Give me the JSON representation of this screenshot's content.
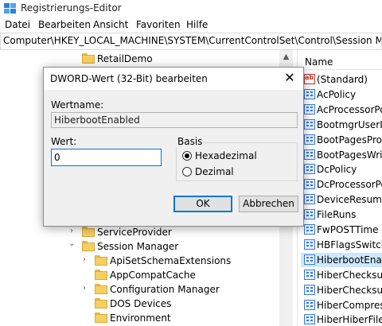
{
  "window": {
    "title": "Registrierungs-Editor",
    "menu": [
      "Datei",
      "Bearbeiten",
      "Ansicht",
      "Favoriten",
      "Hilfe"
    ],
    "address": "Computer\\HKEY_LOCAL_MACHINE\\SYSTEM\\CurrentControlSet\\Control\\Session Manager\\Power"
  },
  "tree": {
    "items": [
      {
        "label": "RetailDemo",
        "expander": ""
      },
      {
        "label": "ServiceProvider",
        "expander": "›"
      },
      {
        "label": "Session Manager",
        "expander": "⌄"
      },
      {
        "label": "ApiSetSchemaExtensions",
        "expander": "›"
      },
      {
        "label": "AppCompatCache",
        "expander": ""
      },
      {
        "label": "Configuration Manager",
        "expander": "›"
      },
      {
        "label": "DOS Devices",
        "expander": ""
      },
      {
        "label": "Environment",
        "expander": ""
      }
    ]
  },
  "values": {
    "column_header": "Name",
    "items": [
      {
        "name": "(Standard)",
        "icon": "string-value-icon"
      },
      {
        "name": "AcPolicy",
        "icon": "binary-value-icon"
      },
      {
        "name": "AcProcessorPolicy",
        "icon": "binary-value-icon"
      },
      {
        "name": "BootmgrUserInputTime",
        "icon": "binary-value-icon"
      },
      {
        "name": "BootPagesProcessed",
        "icon": "binary-value-icon"
      },
      {
        "name": "BootPagesWritten",
        "icon": "binary-value-icon"
      },
      {
        "name": "DcPolicy",
        "icon": "binary-value-icon"
      },
      {
        "name": "DcProcessorPolicy",
        "icon": "binary-value-icon"
      },
      {
        "name": "DeviceResumeTime",
        "icon": "binary-value-icon"
      },
      {
        "name": "FileRuns",
        "icon": "binary-value-icon"
      },
      {
        "name": "FwPOSTTime",
        "icon": "binary-value-icon"
      },
      {
        "name": "HBFlagsSwitch",
        "icon": "binary-value-icon"
      },
      {
        "name": "HiberbootEnabled",
        "icon": "binary-value-icon",
        "selected": true
      },
      {
        "name": "HiberChecksumIoTime",
        "icon": "binary-value-icon"
      },
      {
        "name": "HiberChecksumTime",
        "icon": "binary-value-icon"
      },
      {
        "name": "HiberCompressTime",
        "icon": "binary-value-icon"
      },
      {
        "name": "HiberHiberFileTime",
        "icon": "binary-value-icon"
      }
    ]
  },
  "dialog": {
    "title": "DWORD-Wert (32-Bit) bearbeiten",
    "name_label": "Wertname:",
    "name_value": "HiberbootEnabled",
    "value_label": "Wert:",
    "value_value": "0",
    "basis_label": "Basis",
    "radio_hex": "Hexadezimal",
    "radio_dec": "Dezimal",
    "selected_basis": "Hexadezimal",
    "ok_label": "OK",
    "cancel_label": "Abbrechen",
    "close_glyph": "✕"
  }
}
